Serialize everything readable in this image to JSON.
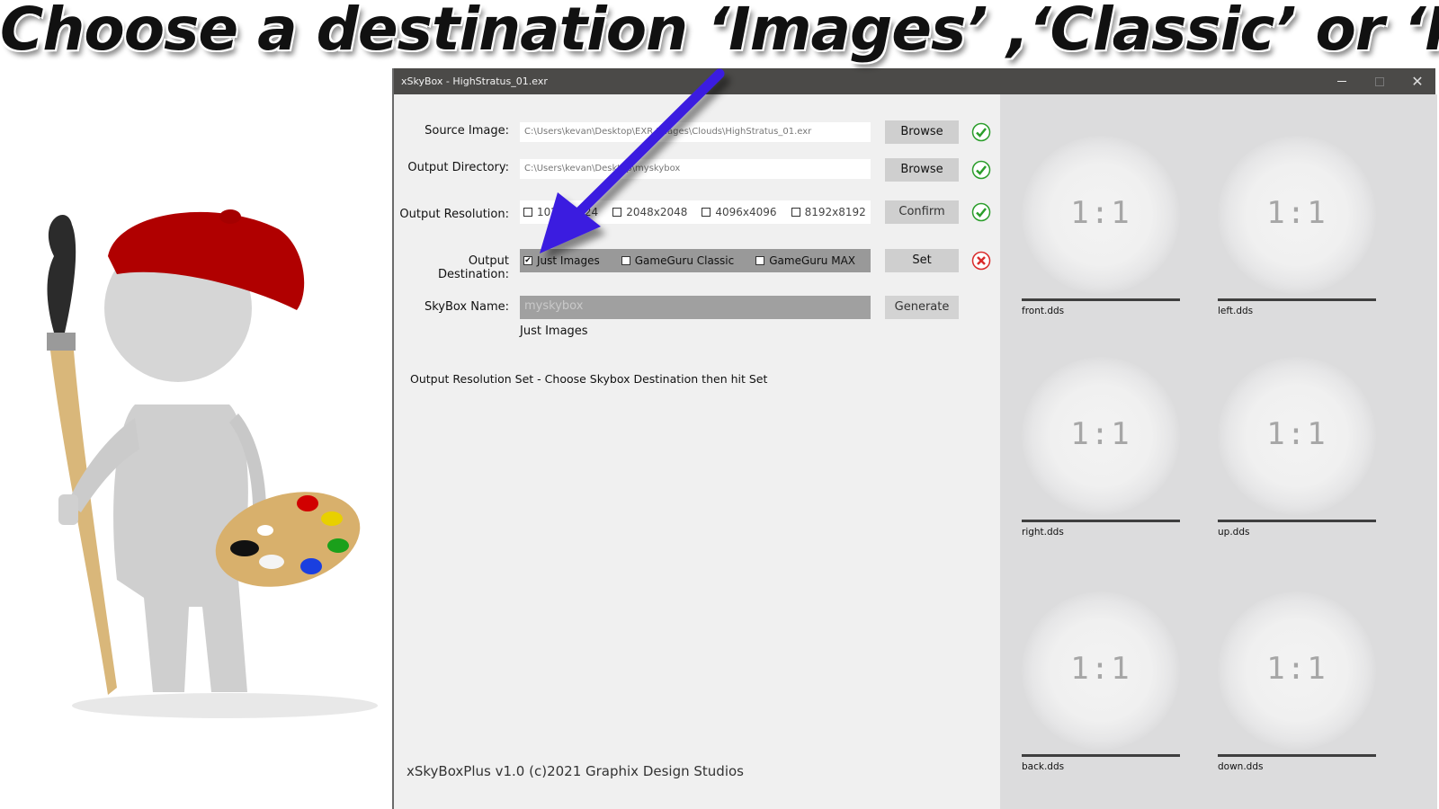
{
  "headline": "Choose a destination ‘Images’ ,‘Classic’ or ‘MAX’",
  "window": {
    "title": "xSkyBox - HighStratus_01.exr",
    "controls": {
      "minimize": "minimize",
      "maximize": "maximize",
      "close": "✕"
    }
  },
  "form": {
    "source_image": {
      "label": "Source Image:",
      "value": "C:\\Users\\kevan\\Desktop\\EXR Images\\Clouds\\HighStratus_01.exr",
      "button": "Browse",
      "status": "ok"
    },
    "output_directory": {
      "label": "Output Directory:",
      "value": "C:\\Users\\kevan\\Desktop\\myskybox",
      "button": "Browse",
      "status": "ok"
    },
    "output_resolution": {
      "label": "Output Resolution:",
      "options": [
        {
          "label": "1024x1024",
          "checked": false
        },
        {
          "label": "2048x2048",
          "checked": false
        },
        {
          "label": "4096x4096",
          "checked": false
        },
        {
          "label": "8192x8192",
          "checked": false
        }
      ],
      "button": "Confirm",
      "status": "ok"
    },
    "output_destination": {
      "label": "Output Destination:",
      "options": [
        {
          "label": "Just Images",
          "checked": true
        },
        {
          "label": "GameGuru Classic",
          "checked": false
        },
        {
          "label": "GameGuru MAX",
          "checked": false
        }
      ],
      "button": "Set",
      "status": "error"
    },
    "skybox_name": {
      "label": "SkyBox Name:",
      "placeholder": "myskybox",
      "button": "Generate",
      "hint": "Just Images"
    },
    "status_message": "Output Resolution Set - Choose Skybox Destination then hit Set",
    "footer": "xSkyBoxPlus v1.0 (c)2021 Graphix Design Studios"
  },
  "preview": {
    "tiles": [
      {
        "ratio": "1:1",
        "file": "front.dds"
      },
      {
        "ratio": "1:1",
        "file": "left.dds"
      },
      {
        "ratio": "1:1",
        "file": "right.dds"
      },
      {
        "ratio": "1:1",
        "file": "up.dds"
      },
      {
        "ratio": "1:1",
        "file": "back.dds"
      },
      {
        "ratio": "1:1",
        "file": "down.dds"
      }
    ]
  },
  "colors": {
    "ok": "#2a9d2a",
    "error": "#d92a2a",
    "arrow": "#3a1ee0",
    "titlebar": "#4b4a48"
  }
}
